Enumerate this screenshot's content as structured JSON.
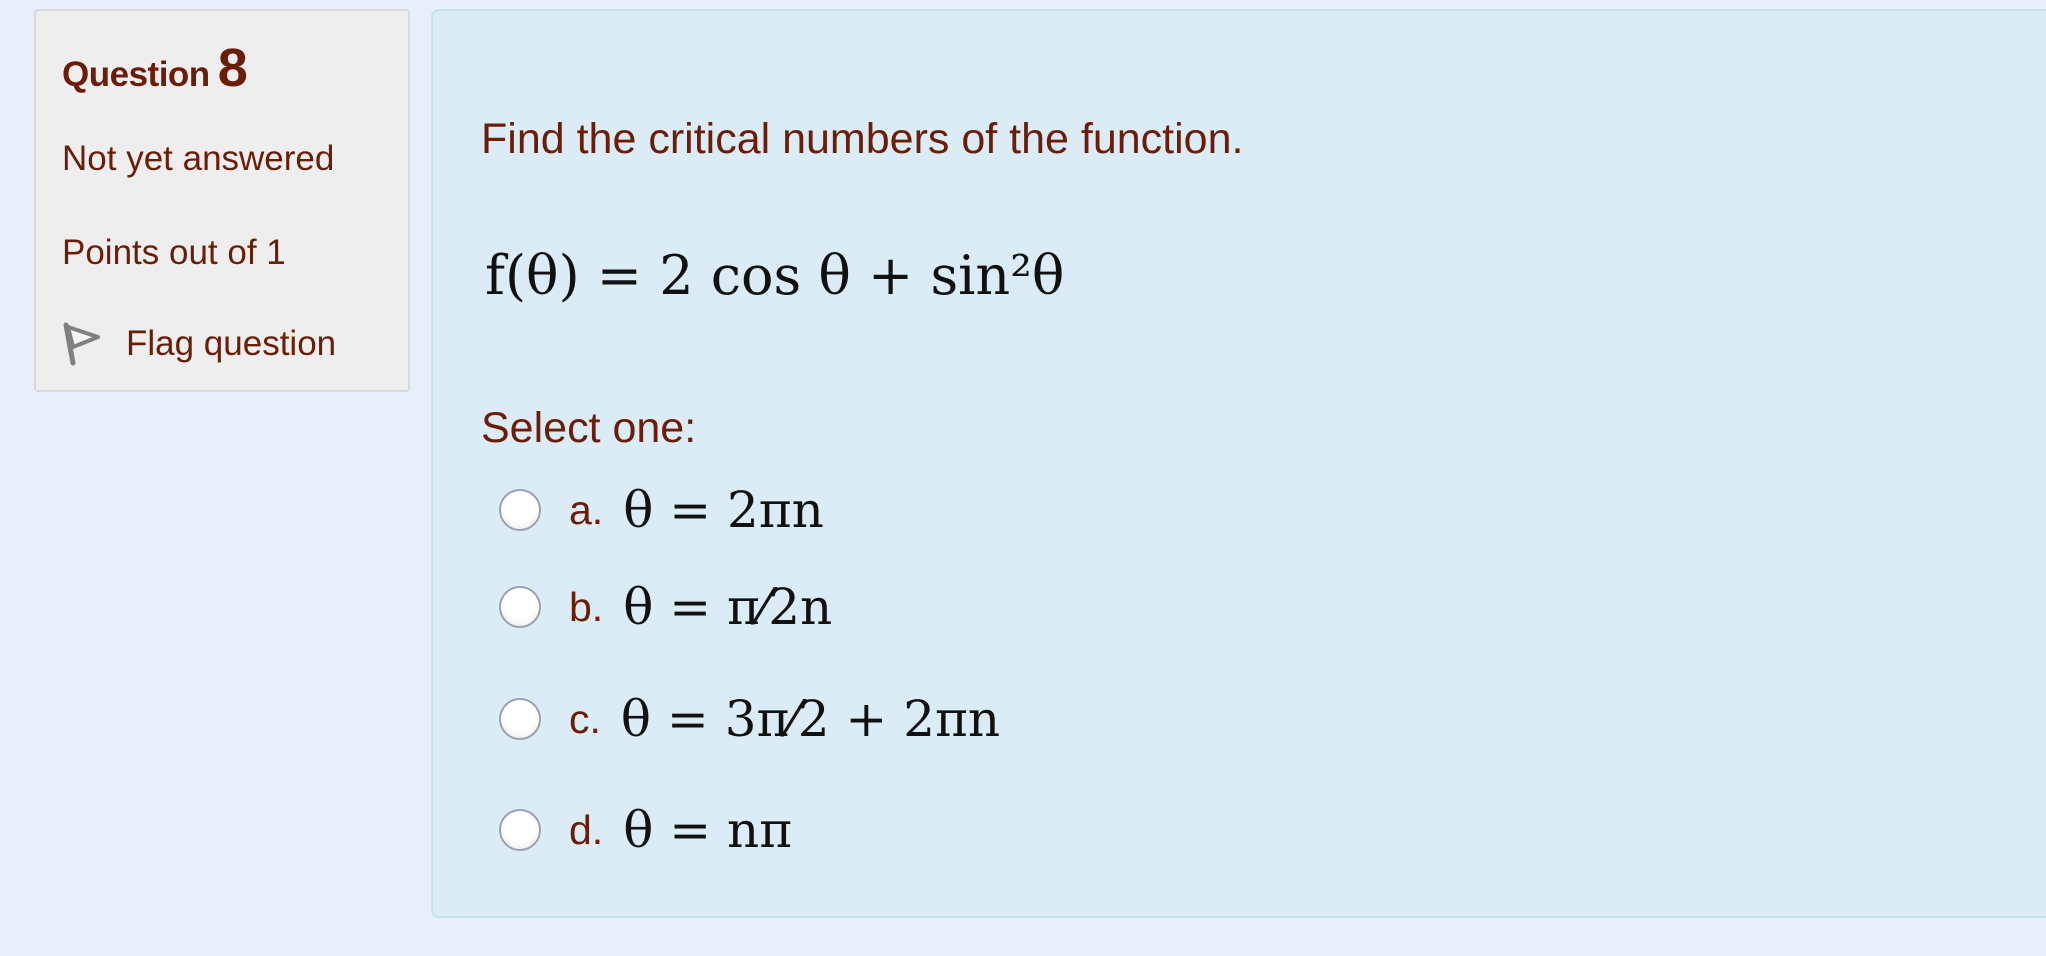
{
  "question": {
    "label": "Question",
    "number": "8",
    "state": "Not yet answered",
    "grade": "Points out of 1",
    "flag_label": "Flag question"
  },
  "content": {
    "prompt": "Find the critical numbers of the function.",
    "formula": "f(θ) = 2 cos θ + sin²θ",
    "select_label": "Select one:",
    "options": [
      {
        "letter": "a.",
        "math": "θ = 2πn"
      },
      {
        "letter": "b.",
        "math": "θ = π⁄2n"
      },
      {
        "letter": "c.",
        "math": "θ = 3π⁄2 + 2πn"
      },
      {
        "letter": "d.",
        "math": "θ = nπ"
      }
    ]
  },
  "colors": {
    "page_background": "#e9eefb",
    "info_panel_background": "#eeeeee",
    "content_panel_background": "#dbecf6",
    "text": "#6b1d08"
  },
  "icons": [
    "flag-icon",
    "radio-icon"
  ]
}
